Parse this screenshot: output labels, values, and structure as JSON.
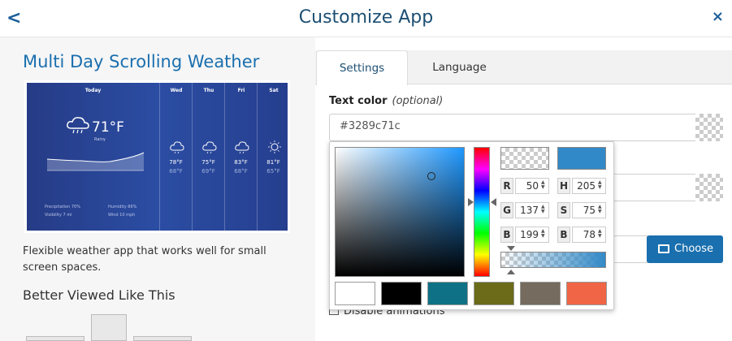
{
  "header": {
    "back_glyph": "<",
    "title": "Customize App",
    "close_glyph": "×"
  },
  "app": {
    "title": "Multi Day Scrolling Weather",
    "description": "Flexible weather app that works well for small screen spaces.",
    "better_viewed": "Better Viewed Like This"
  },
  "preview": {
    "today": {
      "label": "Today",
      "temp": "71°F",
      "condition": "Rainy",
      "stats": [
        "Precipitation 70%",
        "Humidity 86%",
        "Visibility 7 mi",
        "Wind 10 mph"
      ]
    },
    "days": [
      {
        "name": "Wed",
        "high": "78°F",
        "low": "68°F",
        "icon": "cloud-icon"
      },
      {
        "name": "Thu",
        "high": "75°F",
        "low": "69°F",
        "icon": "cloud-icon"
      },
      {
        "name": "Fri",
        "high": "83°F",
        "low": "68°F",
        "icon": "cloud-icon"
      },
      {
        "name": "Sat",
        "high": "81°F",
        "low": "65°F",
        "icon": "sun-icon"
      }
    ]
  },
  "tabs": [
    {
      "label": "Settings",
      "active": true
    },
    {
      "label": "Language",
      "active": false
    }
  ],
  "text_color": {
    "label": "Text color",
    "optional": "(optional)",
    "value": "#3289c71c"
  },
  "picker": {
    "rgb": {
      "r": "50",
      "g": "137",
      "b": "199"
    },
    "hsb": {
      "h": "205",
      "s": "75",
      "b": "78"
    },
    "labels": {
      "r": "R",
      "g": "G",
      "b": "B",
      "h": "H",
      "s": "S",
      "br": "B"
    },
    "current_color": "#3289c7",
    "presets": [
      "#ffffff",
      "#000000",
      "#0e7185",
      "#6b6b1a",
      "#756b5e",
      "#f06545"
    ]
  },
  "choose_button": "Choose",
  "disable_animations": "Disable animations"
}
